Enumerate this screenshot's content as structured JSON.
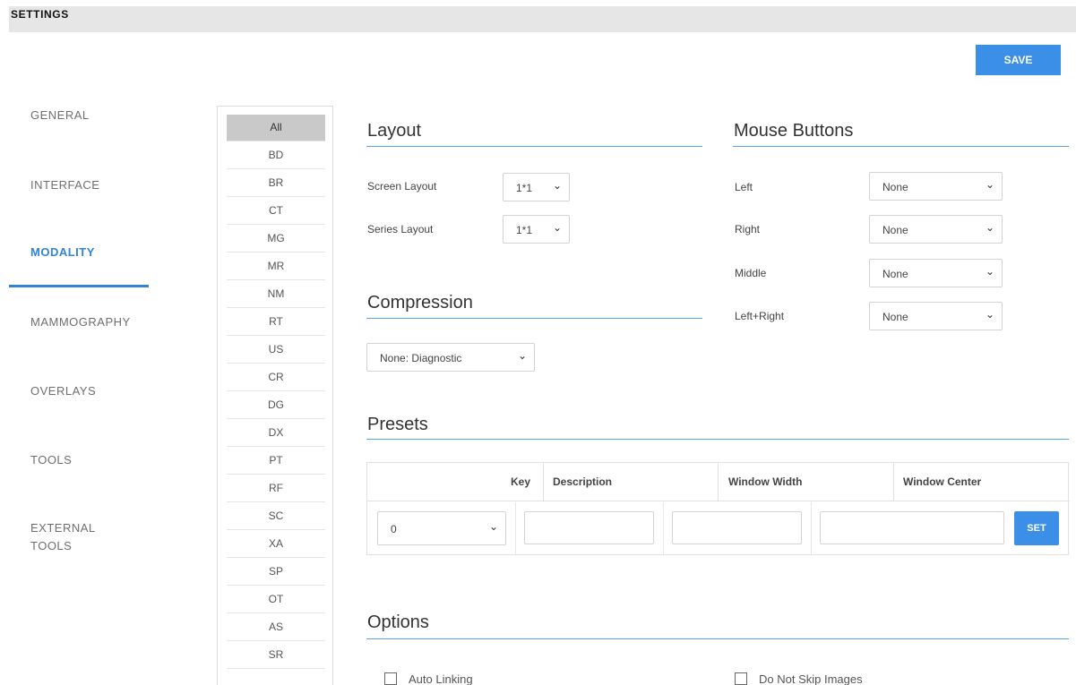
{
  "title": "SETTINGS",
  "save_label": "SAVE",
  "sidebar": {
    "items": [
      {
        "label": "GENERAL"
      },
      {
        "label": "INTERFACE"
      },
      {
        "label": "MODALITY"
      },
      {
        "label": "MAMMOGRAPHY"
      },
      {
        "label": "OVERLAYS"
      },
      {
        "label": "TOOLS"
      },
      {
        "label": "EXTERNAL"
      },
      {
        "label": "TOOLS"
      }
    ],
    "active": "MODALITY"
  },
  "modalities": [
    "All",
    "BD",
    "BR",
    "CT",
    "MG",
    "MR",
    "NM",
    "RT",
    "US",
    "CR",
    "DG",
    "DX",
    "PT",
    "RF",
    "SC",
    "XA",
    "SP",
    "OT",
    "AS",
    "SR"
  ],
  "modality_selected": "All",
  "layout": {
    "title": "Layout",
    "screen_label": "Screen Layout",
    "screen_value": "1*1",
    "series_label": "Series Layout",
    "series_value": "1*1"
  },
  "mouse": {
    "title": "Mouse Buttons",
    "rows": [
      {
        "label": "Left",
        "value": "None"
      },
      {
        "label": "Right",
        "value": "None"
      },
      {
        "label": "Middle",
        "value": "None"
      },
      {
        "label": "Left+Right",
        "value": "None"
      }
    ]
  },
  "compression": {
    "title": "Compression",
    "value": "None: Diagnostic"
  },
  "presets": {
    "title": "Presets",
    "headers": [
      "Key",
      "Description",
      "Window Width",
      "Window Center"
    ],
    "key_value": "0",
    "set_label": "SET"
  },
  "options": {
    "title": "Options",
    "items": [
      "Auto Linking",
      "Do Not Skip Images"
    ]
  },
  "colors": {
    "accent": "#3b8fe6",
    "active_nav": "#3183d6",
    "section_line": "#56a4ea"
  }
}
